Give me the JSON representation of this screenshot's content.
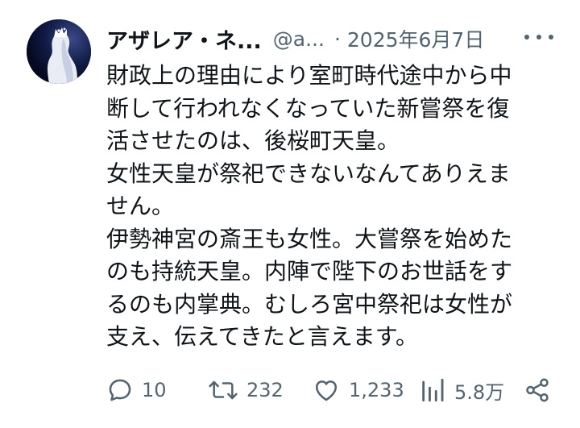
{
  "post": {
    "author_name": "アザレア・ネ...",
    "handle": "@a...",
    "separator": "·",
    "date": "2025年6月7日",
    "lines": [
      "財政上の理由により室町時代途中から中",
      "断して行われなくなっていた新嘗祭を復",
      "活させたのは、後桜町天皇。",
      "女性天皇が祭祀できないなんてありえま",
      "せん。",
      "伊勢神宮の斎王も女性。大嘗祭を始めた",
      "のも持統天皇。内陣で陛下のお世話をす",
      "るのも内掌典。むしろ宮中祭祀は女性が",
      "支え、伝えてきたと言えます。"
    ]
  },
  "actions": {
    "replies": "10",
    "reposts": "232",
    "likes": "1,233",
    "views": "5.8万"
  },
  "icons": {
    "more": "more-dots-icon",
    "reply": "reply-icon",
    "repost": "repost-icon",
    "like": "heart-icon",
    "views": "views-bar-icon",
    "share": "share-icon"
  },
  "colors": {
    "text": "#0f1419",
    "secondary": "#536471",
    "avatar_bg": "#0b1233"
  }
}
